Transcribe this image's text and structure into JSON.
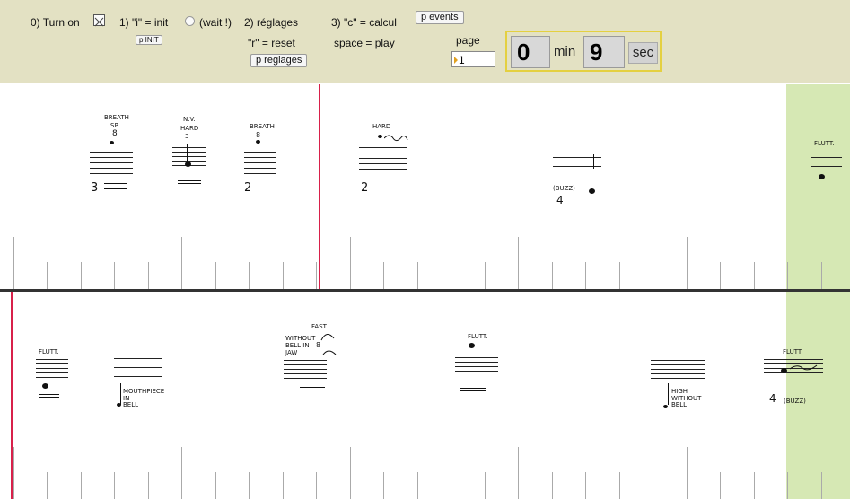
{
  "toolbar": {
    "turn_on_label": "0) Turn on",
    "init_label": "1) \"i\" = init",
    "init_button": "p INIT",
    "wait_label": "(wait !)",
    "reglages_label": "2) réglages",
    "reset_label": "\"r\" = reset",
    "reglages_button": "p reglages",
    "calcul_label": "3) \"c\" = calcul",
    "play_label": "space = play",
    "events_button": "p events",
    "page_label": "page",
    "page_value": "1",
    "minutes_value": "0",
    "minutes_unit": "min",
    "seconds_value": "9",
    "seconds_unit": "sec"
  },
  "colors": {
    "toolbar_bg": "#e3e1c3",
    "playhead": "#d8204a",
    "green_zone": "#d6e8b4",
    "timer_border": "#e4d040"
  },
  "score_top": {
    "annotations": {
      "a1": "BREATH",
      "a1b": "SP.",
      "a1c": "8",
      "a1n": "3",
      "a2": "N.V.",
      "a2b": "HARD",
      "a2c": "3",
      "a3": "BREATH",
      "a3b": "8",
      "a3n": "2",
      "a4": "HARD",
      "a4n": "2",
      "a5": "(BUZZ)",
      "a5n": "4",
      "a6": "FLUTT."
    }
  },
  "score_bottom": {
    "annotations": {
      "b1": "FLUTT.",
      "b2": "MOUTHPIECE",
      "b2b": "IN",
      "b2c": "BELL",
      "b3": "FAST",
      "b3b": "WITHOUT",
      "b3c": "BELL IN",
      "b3d": "JAW",
      "b3e": "8",
      "b4": "FLUTT.",
      "b5": "HIGH",
      "b5b": "WITHOUT",
      "b5c": "BELL",
      "b6": "FLUTT.",
      "b6b": "(BUZZ)",
      "b6n": "4"
    }
  }
}
